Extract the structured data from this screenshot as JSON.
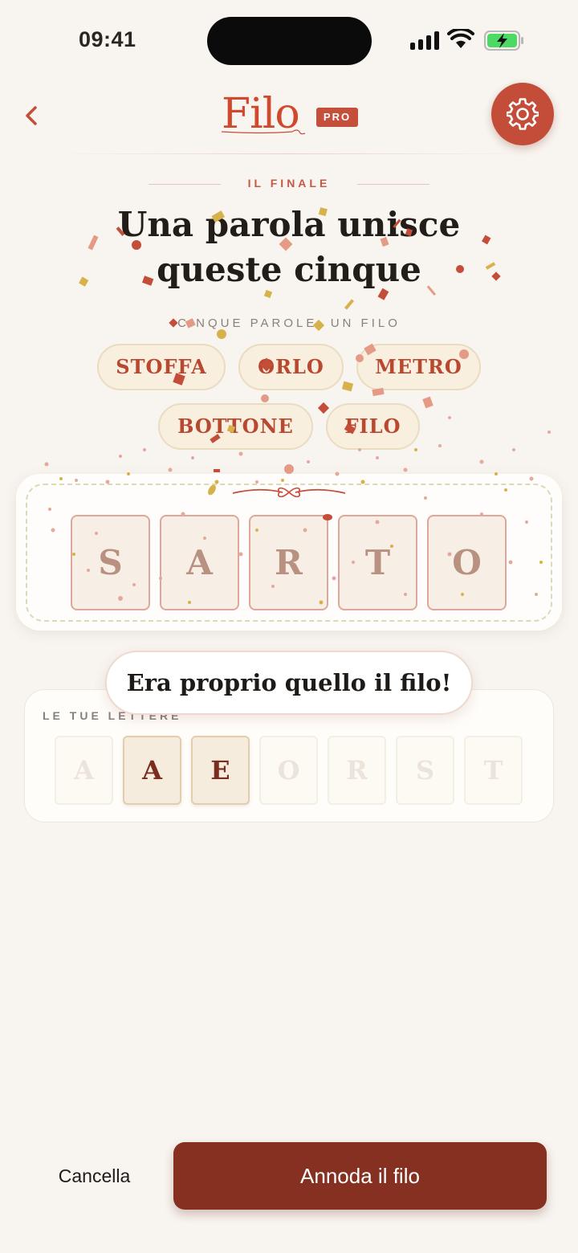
{
  "status": {
    "time": "09:41"
  },
  "header": {
    "logo": "Filo",
    "badge": "PRO"
  },
  "hero": {
    "kicker": "IL FINALE",
    "title_line1": "Una parola unisce",
    "title_line2": "queste cinque",
    "subtitle": "CINQUE PAROLE, UN FILO"
  },
  "clues": [
    "STOFFA",
    "ORLO",
    "METRO",
    "BOTTONE",
    "FILO"
  ],
  "answer": {
    "tiles": [
      "S",
      "A",
      "R",
      "T",
      "O"
    ]
  },
  "toast": "Era proprio quello il filo!",
  "letters": {
    "label": "LE TUE LETTERE",
    "tiles": [
      {
        "letter": "A",
        "state": "used"
      },
      {
        "letter": "A",
        "state": "available"
      },
      {
        "letter": "E",
        "state": "available"
      },
      {
        "letter": "O",
        "state": "used"
      },
      {
        "letter": "R",
        "state": "used"
      },
      {
        "letter": "S",
        "state": "used"
      },
      {
        "letter": "T",
        "state": "used"
      }
    ]
  },
  "actions": {
    "cancel": "Cancella",
    "primary": "Annoda il filo"
  },
  "colors": {
    "accent": "#c44d39",
    "primary": "#853021",
    "background": "#f8f4ef"
  }
}
